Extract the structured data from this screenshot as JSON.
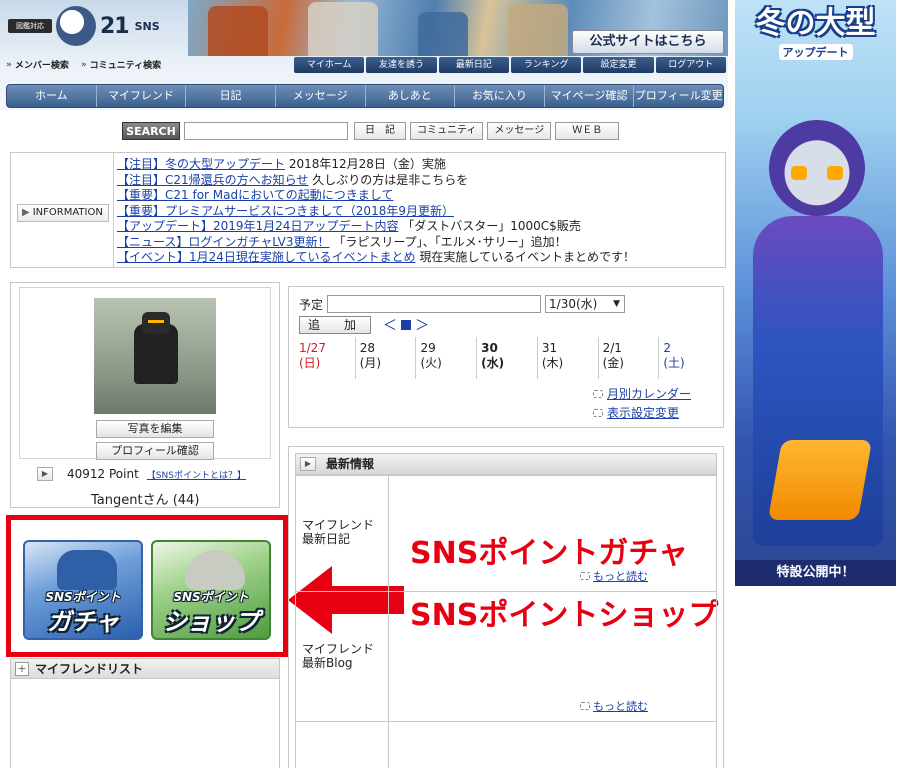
{
  "header": {
    "logo_badge": "図鑑対応",
    "logo_mark": "C",
    "logo_text": "21",
    "logo_sns": "SNS",
    "member_search": "メンバー検索",
    "community_search": "コミュニティ検索",
    "official_site": "公式サイトはこちら",
    "top_nav": [
      "マイホーム",
      "友達を誘う",
      "最新日記",
      "ランキング",
      "設定変更",
      "ログアウト"
    ],
    "main_nav": [
      "ホーム",
      "マイフレンド",
      "日記",
      "メッセージ",
      "あしあと",
      "お気に入り",
      "マイページ確認",
      "プロフィール変更"
    ]
  },
  "search": {
    "label": "SEARCH",
    "value": "",
    "buttons": [
      "日　記",
      "コミュニティ",
      "メッセージ",
      "ＷＥＢ"
    ]
  },
  "information": {
    "label": "INFORMATION",
    "items": [
      {
        "link": "【注目】冬の大型アップデート",
        "text": " 2018年12月28日（金）実施"
      },
      {
        "link": "【注目】C21帰還兵の方へお知らせ",
        "text": " 久しぶりの方は是非こちらを"
      },
      {
        "link": "【重要】C21 for Madにおいての起動につきまして",
        "text": ""
      },
      {
        "link": "【重要】プレミアムサービスにつきまして（2018年9月更新）",
        "text": ""
      },
      {
        "link": "【アップデート】2019年1月24日アップデート内容",
        "text": " 「ダストバスター」1000C$販売"
      },
      {
        "link": "【ニュース】ログインガチャLV3更新！",
        "text": " 「ラピスリープ」、「エルメ･サリー」追加！"
      },
      {
        "link": "【イベント】1月24日現在実施しているイベントまとめ",
        "text": " 現在実施しているイベントまとめです！"
      }
    ]
  },
  "profile": {
    "edit_photo": "写真を編集",
    "check_profile": "プロフィール確認",
    "points": "40912 Point",
    "points_help": "【SNSポイントとは？】",
    "username": "Tangentさん (44)"
  },
  "banners": {
    "gacha_line1": "SNSポイント",
    "gacha_line2": "ガチャ",
    "shop_line1": "SNSポイント",
    "shop_line2": "ショップ"
  },
  "annotation": {
    "gacha": "SNSポイントガチャ",
    "shop": "SNSポイントショップ",
    "color": "#e60012"
  },
  "friend_list": {
    "title": "マイフレンドリスト"
  },
  "schedule": {
    "label": "予定",
    "value": "",
    "selected_date": "1/30(水)",
    "add_button": "追　加",
    "nav_prev": "＜",
    "nav_next": "＞",
    "days": [
      {
        "date": "1/27",
        "dow": "(日)",
        "type": "sun"
      },
      {
        "date": "28",
        "dow": "(月)",
        "type": ""
      },
      {
        "date": "29",
        "dow": "(火)",
        "type": ""
      },
      {
        "date": "30",
        "dow": "(水)",
        "type": "today"
      },
      {
        "date": "31",
        "dow": "(木)",
        "type": ""
      },
      {
        "date": "2/1",
        "dow": "(金)",
        "type": ""
      },
      {
        "date": "2",
        "dow": "(土)",
        "type": "sat"
      }
    ],
    "monthly_calendar": "月別カレンダー",
    "display_settings": "表示設定変更"
  },
  "news": {
    "title": "最新情報",
    "rows": [
      {
        "caption_1": "マイフレンド",
        "caption_2": "最新日記",
        "more": "もっと読む"
      },
      {
        "caption_1": "マイフレンド",
        "caption_2": "最新Blog",
        "more": "もっと読む"
      }
    ]
  },
  "side_banner": {
    "title": "冬の大型",
    "subtitle": "アップデート",
    "footer": "特設公開中！"
  }
}
